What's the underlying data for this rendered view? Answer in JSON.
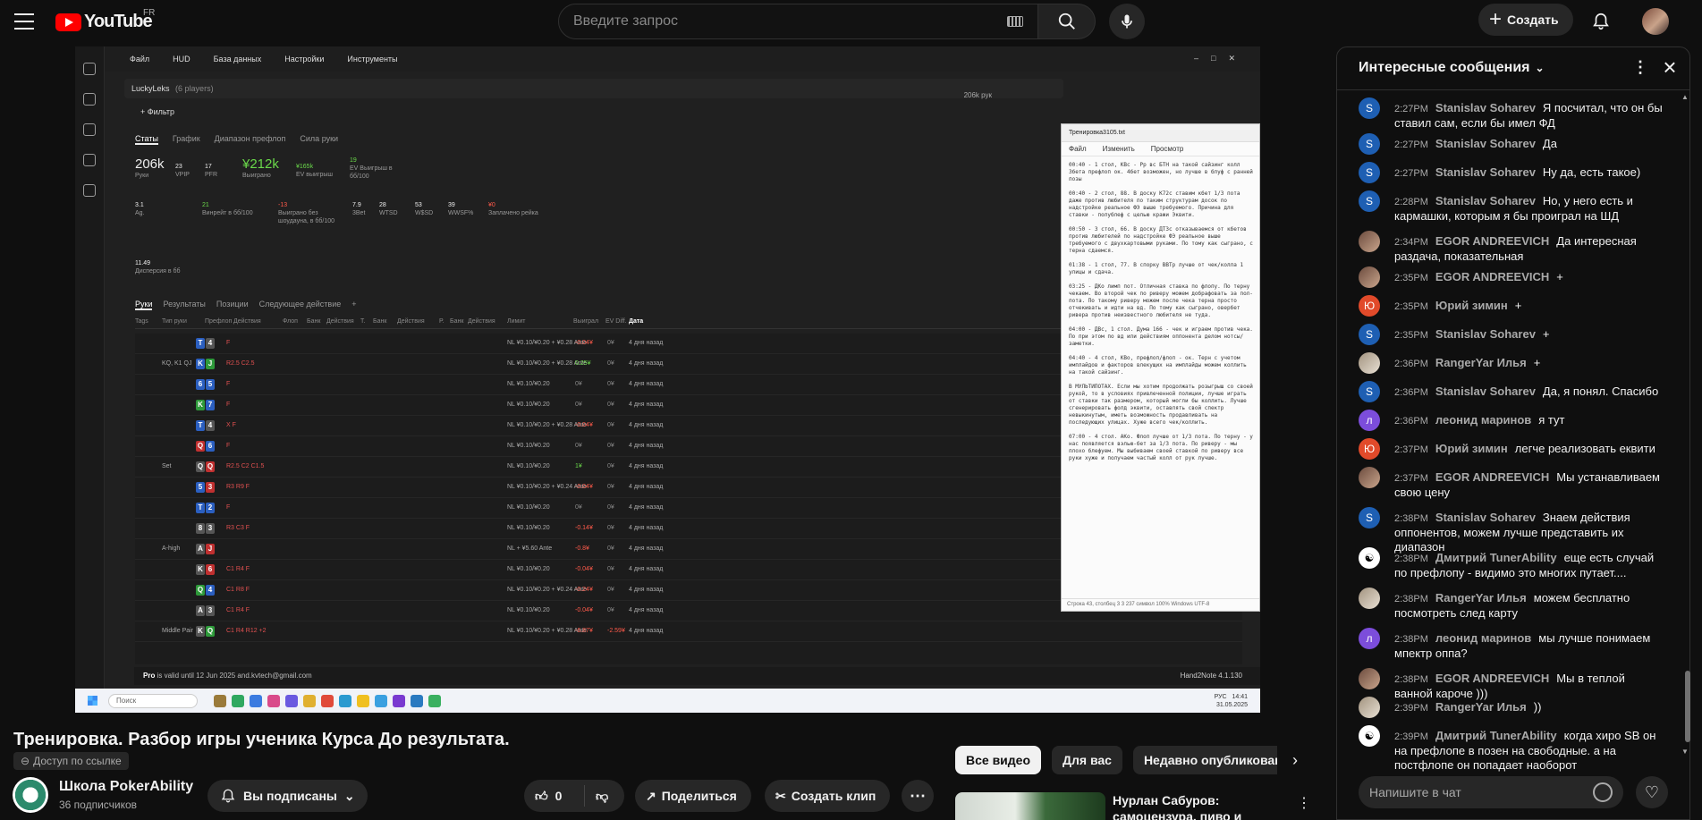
{
  "header": {
    "logo_text": "YouTube",
    "country": "FR",
    "search_placeholder": "Введите запрос",
    "create_label": "Создать"
  },
  "video": {
    "app": {
      "menu": [
        "Файл",
        "HUD",
        "База данных",
        "Настройки",
        "Инструменты"
      ],
      "player": "LuckyLeks",
      "players_count": "(6 players)",
      "hands_ev": "206k рук",
      "filter_label": "+ Фильтр",
      "tabs": [
        "Статы",
        "График",
        "Диапазон префлоп",
        "Сила руки"
      ],
      "stats": {
        "hands_val": "206k",
        "hands_lbl": "Руки",
        "vpip_val": "23",
        "vpip_lbl": "VPIP",
        "pfr_val": "17",
        "pfr_lbl": "PFR",
        "won_val": "¥212k",
        "won_lbl": "Выиграно",
        "ev_val": "¥165k",
        "ev_lbl": "EV выигрыш",
        "ev100_val": "19",
        "ev100_lbl": "EV Выигрыш в бб/100",
        "agg_val": "3.1",
        "agg_lbl": "Ag.",
        "bb100_val": "21",
        "bb100_lbl": "Винрейт в бб/100",
        "nsd_val": "-13",
        "nsd_lbl": "Выиграно без шоудауна, в бб/100",
        "bet3_val": "7.9",
        "bet3_lbl": "3Bet",
        "wtsd_val": "28",
        "wtsd_lbl": "WTSD",
        "wsd_val": "53",
        "wsd_lbl": "W$SD",
        "wwsf_val": "39",
        "wwsf_lbl": "WWSF%",
        "rake_val": "¥0",
        "rake_lbl": "Заплачено рейка",
        "var_val": "11.49",
        "var_lbl": "Дисперсия в бб"
      },
      "tabs2": [
        "Руки",
        "Результаты",
        "Позиции",
        "Следующее действие",
        "+"
      ],
      "columns": [
        "Tags",
        "Тип руки",
        "Префлоп",
        "Действия",
        "Флоп",
        "Банк",
        "Действия",
        "Т.",
        "Банк",
        "Действия",
        "Р.",
        "Банк",
        "Действия",
        "Лимит",
        "Выиграл",
        "EV Diff.",
        "Дата"
      ],
      "rows": [
        {
          "type": "",
          "cards": [
            [
              "T",
              "c-b"
            ],
            [
              "4",
              "c-k"
            ]
          ],
          "pre": "F",
          "limit": "NL ¥0.10/¥0.20 + ¥0.28 Ante",
          "won": "-0.04¥",
          "ev": "0¥",
          "date": "4 дня назад"
        },
        {
          "type": "KQ, K1 QJ",
          "cards": [
            [
              "K",
              "c-b"
            ],
            [
              "J",
              "c-g"
            ]
          ],
          "pre": "R2.5 C2.5",
          "limit": "NL ¥0.10/¥0.20 + ¥0.28 Ante",
          "won": "0.25¥",
          "ev": "0¥",
          "date": "4 дня назад"
        },
        {
          "type": "",
          "cards": [
            [
              "6",
              "c-b"
            ],
            [
              "5",
              "c-b"
            ]
          ],
          "pre": "F",
          "limit": "NL ¥0.10/¥0.20",
          "won": "0¥",
          "ev": "0¥",
          "date": "4 дня назад"
        },
        {
          "type": "",
          "cards": [
            [
              "K",
              "c-g"
            ],
            [
              "7",
              "c-b"
            ]
          ],
          "pre": "F",
          "limit": "NL ¥0.10/¥0.20",
          "won": "0¥",
          "ev": "0¥",
          "date": "4 дня назад"
        },
        {
          "type": "",
          "cards": [
            [
              "T",
              "c-b"
            ],
            [
              "4",
              "c-k"
            ]
          ],
          "pre": "X F",
          "limit": "NL ¥0.10/¥0.20 + ¥0.28 Ante",
          "won": "-0.04¥",
          "ev": "0¥",
          "date": "4 дня назад"
        },
        {
          "type": "",
          "cards": [
            [
              "Q",
              "c-r"
            ],
            [
              "6",
              "c-b"
            ]
          ],
          "pre": "F",
          "limit": "NL ¥0.10/¥0.20",
          "won": "0¥",
          "ev": "0¥",
          "date": "4 дня назад"
        },
        {
          "type": "Set",
          "cards": [
            [
              "Q",
              "c-k"
            ],
            [
              "Q",
              "c-r"
            ]
          ],
          "pre": "R2.5 C2 C1.5",
          "limit": "NL ¥0.10/¥0.20",
          "won": "1¥",
          "ev": "0¥",
          "date": "4 дня назад"
        },
        {
          "type": "",
          "cards": [
            [
              "5",
              "c-b"
            ],
            [
              "3",
              "c-r"
            ]
          ],
          "pre": "R3 R9 F",
          "limit": "NL ¥0.10/¥0.20 + ¥0.24 Ante",
          "won": "-0.04¥",
          "ev": "0¥",
          "date": "4 дня назад"
        },
        {
          "type": "",
          "cards": [
            [
              "T",
              "c-b"
            ],
            [
              "2",
              "c-b"
            ]
          ],
          "pre": "F",
          "limit": "NL ¥0.10/¥0.20",
          "won": "0¥",
          "ev": "0¥",
          "date": "4 дня назад"
        },
        {
          "type": "",
          "cards": [
            [
              "8",
              "c-k"
            ],
            [
              "3",
              "c-k"
            ]
          ],
          "pre": "R3 C3 F",
          "limit": "NL ¥0.10/¥0.20",
          "won": "-0.14¥",
          "ev": "0¥",
          "date": "4 дня назад"
        },
        {
          "type": "A-high",
          "cards": [
            [
              "A",
              "c-k"
            ],
            [
              "J",
              "c-r"
            ]
          ],
          "pre": "",
          "limit": "NL + ¥5.60 Ante",
          "won": "-0.8¥",
          "ev": "0¥",
          "date": "4 дня назад"
        },
        {
          "type": "",
          "cards": [
            [
              "K",
              "c-k"
            ],
            [
              "6",
              "c-r"
            ]
          ],
          "pre": "C1 R4 F",
          "limit": "NL ¥0.10/¥0.20",
          "won": "-0.04¥",
          "ev": "0¥",
          "date": "4 дня назад"
        },
        {
          "type": "",
          "cards": [
            [
              "Q",
              "c-g"
            ],
            [
              "4",
              "c-b"
            ]
          ],
          "pre": "C1 R8 F",
          "limit": "NL ¥0.10/¥0.20 + ¥0.24 Ante",
          "won": "-0.24¥",
          "ev": "0¥",
          "date": "4 дня назад"
        },
        {
          "type": "",
          "cards": [
            [
              "A",
              "c-k"
            ],
            [
              "3",
              "c-k"
            ]
          ],
          "pre": "C1 R4 F",
          "limit": "NL ¥0.10/¥0.20",
          "won": "-0.04¥",
          "ev": "0¥",
          "date": "4 дня назад"
        },
        {
          "type": "Middle Pair",
          "cards": [
            [
              "K",
              "c-k"
            ],
            [
              "Q",
              "c-g"
            ]
          ],
          "pre": "C1 R4 R12 +2",
          "limit": "NL ¥0.10/¥0.20 + ¥0.28 Ante",
          "won": "-6.87¥",
          "ev": "-2.59¥",
          "date": "4 дня назад"
        }
      ],
      "status_pro": "Pro",
      "status_text": "is valid until 12 Jun 2025   and.kvtech@gmail.com",
      "version": "Hand2Note 4.1.130",
      "taskbar_search": "Поиск",
      "clock_time": "14:41",
      "clock_date": "31.05.2025",
      "tray_lang": "РУС"
    },
    "notepad": {
      "title": "Тренировка3105.txt",
      "menu": [
        "Файл",
        "Изменить",
        "Просмотр"
      ],
      "lines": [
        "00:40 - 1 стол, КВс - Рр вс БТН на такой сайзинг колл 3бета префлоп ок. 4бет возможен, но лучше в блуф с ранней позы",
        "00:40 - 2 стол, 88. В доску K72с ставим кбет 1/3 пота даже против любителя по таким структурам досок по надстройке реальное ФЭ выше требуемого. Причина для ставки - полублеф с целью кражи Эквити.",
        "00:50 - 3 стол, 66. В доску ДТ3с отказываемся от кбетов против любителей по надстройке ФЭ реальное выше требуемого с двухкартовыми руками. По тому как сыграно, с терна сдаемся.",
        "01:38 - 1 стол, 77. В спорку ВВТр лучше от чек/колла 1 улицы и сдача.",
        "03:25 - ДКо лимп пот. Отличная ставка по флопу. По терну чекаем. Во второй чек по риверу можем добрафовать за пол-пота. По такому риверу можем после чека терна просто отчекивать и идти на вд. По тому как сыграно, овербет ривера против неизвестного любителя не туда.",
        "04:00 - ДВс, 1 стол. Дума 166 - чек и играем против чека. По при этом по вд или действиям оппонента делом нотсы/заметки.",
        "04:40 - 4 стол, КВо, префлоп/флоп - ок. Терн с учетом имплайдов и факторов влекущих на имплайды можем коллить на такой сайзинг.",
        "В МУЛЬТИПОТАХ. Если мы хотим продолжать розыгрыш со своей рукой, то в условиях привлеченной полиции, лучше играть от ставки так размером, который могли бы коллить. Лучше сгенерировать фолд эквити, оставлять свой спектр невыкинутым, иметь возможность продавливать на последующих улицах. Хуже всего чек/коллить.",
        "07:00 - 4 стол. АКо. Флоп лучше от 1/3 пота. По терну - у нас появляется вэлью-бет за 1/3 пота. По риверу - мы плохо блефуем. Мы выбиваем своей ставкой по риверу все руки хуже и получаем частый колл от рук лучше."
      ],
      "status": "Строка 43, столбец 3   3 237 символ   100%   Windows   UTF-8"
    }
  },
  "meta": {
    "title": "Тренировка. Разбор игры ученика Курса До результата.",
    "access": "Доступ по ссылке",
    "channel_name": "Школа PokerAbility",
    "subscribers": "36 подписчиков",
    "subscribed_label": "Вы подписаны",
    "likes": "0",
    "share_label": "Поделиться",
    "clip_label": "Создать клип"
  },
  "recommendations": {
    "chips": [
      "Все видео",
      "Для вас",
      "Недавно опубликованн"
    ],
    "first_title": "Нурлан Сабуров: самоцензура, пиво и аресты"
  },
  "chat": {
    "title": "Интересные сообщения",
    "input_placeholder": "Напишите в чат",
    "messages": [
      {
        "initial": "S",
        "av": "av-s",
        "time": "2:27PM",
        "author": "Stanislav Soharev",
        "text": "Я посчитал, что он бы ставил сам, если бы имел ФД"
      },
      {
        "initial": "S",
        "av": "av-s",
        "time": "2:27PM",
        "author": "Stanislav Soharev",
        "text": "Да"
      },
      {
        "initial": "S",
        "av": "av-s",
        "time": "2:27PM",
        "author": "Stanislav Soharev",
        "text": "Ну да, есть такое)"
      },
      {
        "initial": "S",
        "av": "av-s",
        "time": "2:28PM",
        "author": "Stanislav Soharev",
        "text": "Но, у него есть и кармашки, которым я бы проиграл на ШД"
      },
      {
        "initial": "",
        "av": "av-e",
        "time": "2:34PM",
        "author": "EGOR ANDREEVICH",
        "text": "Да интересная раздача, показательная"
      },
      {
        "initial": "",
        "av": "av-e",
        "time": "2:35PM",
        "author": "EGOR ANDREEVICH",
        "text": "+"
      },
      {
        "initial": "Ю",
        "av": "av-y",
        "time": "2:35PM",
        "author": "Юрий зимин",
        "text": "+"
      },
      {
        "initial": "S",
        "av": "av-s",
        "time": "2:35PM",
        "author": "Stanislav Soharev",
        "text": "+"
      },
      {
        "initial": "",
        "av": "av-r",
        "time": "2:36PM",
        "author": "RangerYar Илья",
        "text": "+"
      },
      {
        "initial": "S",
        "av": "av-s",
        "time": "2:36PM",
        "author": "Stanislav Soharev",
        "text": "Да, я понял. Спасибо"
      },
      {
        "initial": "л",
        "av": "av-l",
        "time": "2:36PM",
        "author": "леонид маринов",
        "text": "я тут"
      },
      {
        "initial": "Ю",
        "av": "av-y",
        "time": "2:37PM",
        "author": "Юрий зимин",
        "text": "легче реализовать еквити"
      },
      {
        "initial": "",
        "av": "av-e",
        "time": "2:37PM",
        "author": "EGOR ANDREEVICH",
        "text": "Мы устанавливаем свою цену"
      },
      {
        "initial": "S",
        "av": "av-s",
        "time": "2:38PM",
        "author": "Stanislav Soharev",
        "text": "Знаем действия оппонентов, можем лучше представить их диапазон"
      },
      {
        "initial": "☯",
        "av": "av-d",
        "time": "2:38PM",
        "author": "Дмитрий TunerAbility",
        "text": "еще есть случай по префлопу - видимо это многих путает...."
      },
      {
        "initial": "",
        "av": "av-r",
        "time": "2:38PM",
        "author": "RangerYar Илья",
        "text": "можем бесплатно посмотреть след карту"
      },
      {
        "initial": "л",
        "av": "av-l",
        "time": "2:38PM",
        "author": "леонид маринов",
        "text": "мы лучше понимаем мпектр оппа?"
      },
      {
        "initial": "",
        "av": "av-e",
        "time": "2:38PM",
        "author": "EGOR ANDREEVICH",
        "text": "Мы в теплой ванной кароче )))"
      },
      {
        "initial": "",
        "av": "av-r",
        "time": "2:39PM",
        "author": "RangerYar Илья",
        "text": "))"
      },
      {
        "initial": "☯",
        "av": "av-d",
        "time": "2:39PM",
        "author": "Дмитрий TunerAbility",
        "text": "когда хиро SB он на префлопе в позен на свободные. а на постфлопе он попадает наоборот"
      }
    ]
  }
}
